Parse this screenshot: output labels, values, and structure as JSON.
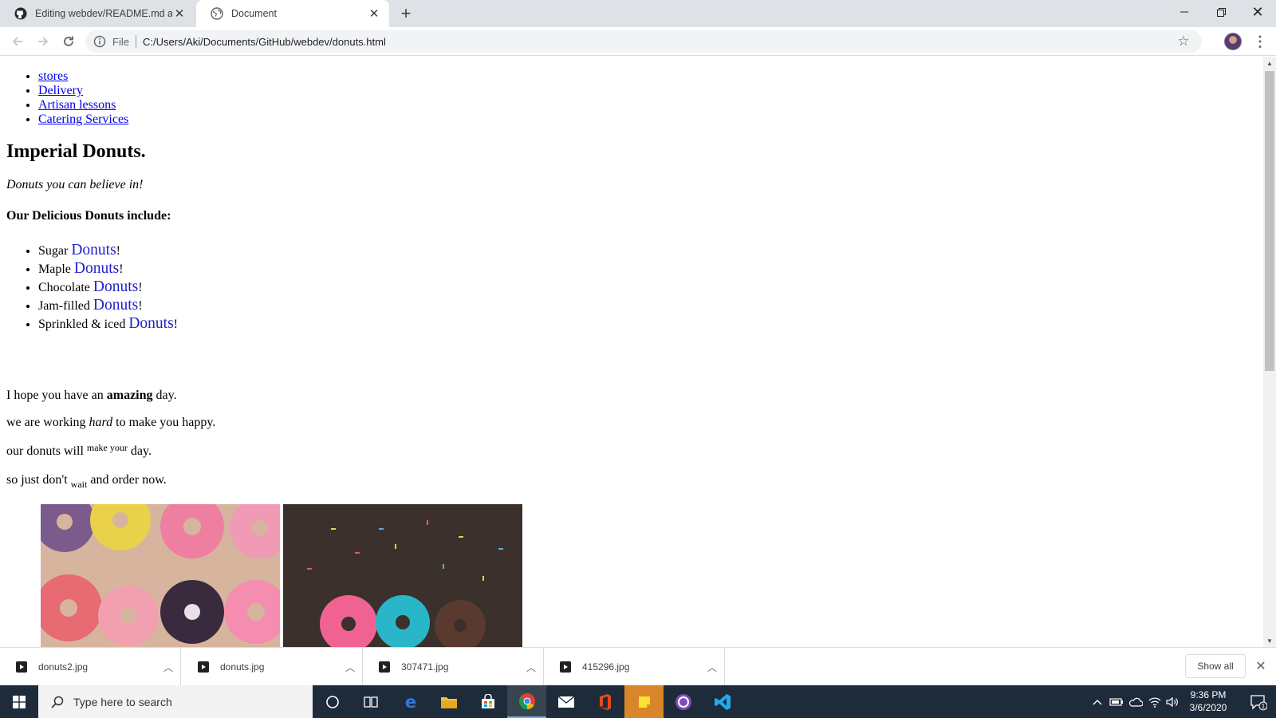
{
  "browser": {
    "tabs": [
      {
        "title": "Editing webdev/README.md at m",
        "active": false
      },
      {
        "title": "Document",
        "active": true
      }
    ],
    "address": {
      "scheme": "File",
      "url": "C:/Users/Aki/Documents/GitHub/webdev/donuts.html"
    }
  },
  "page": {
    "nav": [
      "stores",
      "Delivery",
      "Artisan lessons",
      "Catering Services"
    ],
    "heading": "Imperial Donuts.",
    "tagline": "Donuts you can believe in!",
    "subheading": "Our Delicious Donuts include:",
    "donuts": [
      {
        "prefix": "Sugar ",
        "word": "Donuts",
        "suffix": "!"
      },
      {
        "prefix": "Maple ",
        "word": "Donuts",
        "suffix": "!"
      },
      {
        "prefix": "Chocolate ",
        "word": "Donuts",
        "suffix": "!"
      },
      {
        "prefix": "Jam-filled ",
        "word": "Donuts",
        "suffix": "!"
      },
      {
        "prefix": "Sprinkled & iced ",
        "word": "Donuts",
        "suffix": "!"
      }
    ],
    "p1": {
      "before": "I hope you have an ",
      "bold": "amazing",
      "after": " day."
    },
    "p2": {
      "before": "we are working ",
      "italic": "hard",
      "after": " to make you happy."
    },
    "p3": {
      "before": "our donuts will ",
      "sup": "make your",
      "after": " day."
    },
    "p4": {
      "before": "so just don't ",
      "sub": "wait",
      "after": " and order now."
    }
  },
  "downloads": {
    "items": [
      "donuts2.jpg",
      "donuts.jpg",
      "307471.jpg",
      "415296.jpg"
    ],
    "show_all": "Show all"
  },
  "taskbar": {
    "search_placeholder": "Type here to search",
    "time": "9:36 PM",
    "date": "3/6/2020",
    "notification_count": "1"
  },
  "colors": {
    "link": "#0000ee",
    "donut_word": "#2020cc",
    "taskbar": "#1e2b3a",
    "tabstrip": "#dee1e6"
  }
}
